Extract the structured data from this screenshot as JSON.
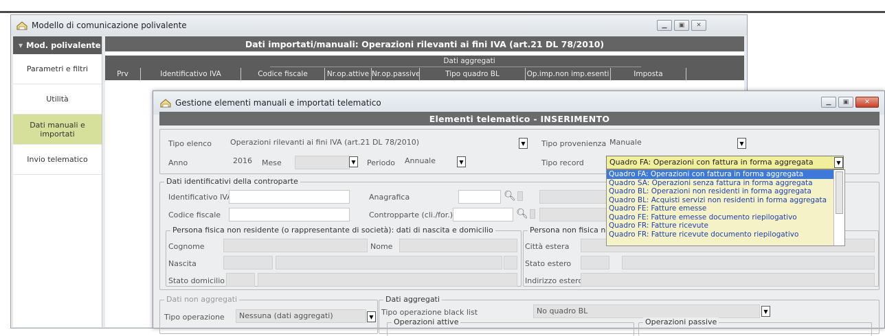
{
  "bg_window": {
    "title": "Modello di comunicazione polivalente",
    "sidebar": {
      "header": "Mod. polivalente",
      "items": [
        {
          "label": "Parametri e filtri"
        },
        {
          "label": "Utilità"
        },
        {
          "label": "Dati manuali e importati"
        },
        {
          "label": "Invio telematico"
        }
      ]
    },
    "main_header": "Dati importati/manuali: Operazioni rilevanti ai fini IVA (art.21 DL 78/2010)",
    "group_label": "Dati aggregati",
    "columns": [
      "Prv",
      "Identificativo IVA",
      "Codice fiscale",
      "Nr.op.attive",
      "Nr.op.passive",
      "Tipo quadro BL",
      "Op.imp.non imp.esenti",
      "Imposta"
    ]
  },
  "dialog": {
    "title": "Gestione elementi manuali e importati telematico",
    "header": "Elementi telematico - INSERIMENTO",
    "tipo_elenco": {
      "label": "Tipo elenco",
      "value": "Operazioni rilevanti ai fini IVA (art.21 DL 78/2010)"
    },
    "tipo_provenienza": {
      "label": "Tipo provenienza",
      "value": "Manuale"
    },
    "anno": {
      "label": "Anno",
      "value": "2016"
    },
    "mese": {
      "label": "Mese",
      "value": ""
    },
    "periodo": {
      "label": "Periodo",
      "value": "Annuale"
    },
    "tipo_record": {
      "label": "Tipo record",
      "value": "Quadro FA: Operazioni con fattura in forma aggregata"
    },
    "tipo_record_options": [
      "Quadro FA: Operazioni con fattura in forma aggregata",
      "Quadro SA: Operazioni senza fattura in forma aggregata",
      "Quadro BL: Operazioni non residenti in forma aggregata",
      "Quadro BL: Acquisti servizi non residenti in forma aggregata",
      "Quadro FE: Fatture emesse",
      "Quadro FE: Fatture emesse documento riepilogativo",
      "Quadro FR: Fatture ricevute",
      "Quadro FR: Fatture ricevute documento riepilogativo"
    ],
    "contro": {
      "title": "Dati identificativi della controparte",
      "id_iva": "Identificativo IVA",
      "codice_fiscale": "Codice fiscale",
      "anagrafica": "Anagrafica",
      "controparte": "Contropparte (cli./for.)"
    },
    "persona_fisica": {
      "title": "Persona fisica non residente (o rappresentante di società): dati di nascita e domicilio",
      "cognome": "Cognome",
      "nome": "Nome",
      "nascita": "Nascita",
      "stato_domicilio": "Stato domicilio"
    },
    "persona_non_fisica": {
      "title": "Persona non fisica non",
      "citta_estera": "Città estera",
      "stato_estero": "Stato estero",
      "indirizzo_estero": "Indirizzo estero"
    },
    "non_aggregati": {
      "title": "Dati non aggregati",
      "tipo_operazione": "Tipo operazione",
      "tipo_operazione_value": "Nessuna (dati aggregati)"
    },
    "aggregati": {
      "title": "Dati aggregati",
      "tipo_black_list": "Tipo operazione black list",
      "tipo_black_list_value": "No quadro BL",
      "op_attive": "Operazioni attive",
      "op_passive": "Operazioni passive"
    }
  }
}
